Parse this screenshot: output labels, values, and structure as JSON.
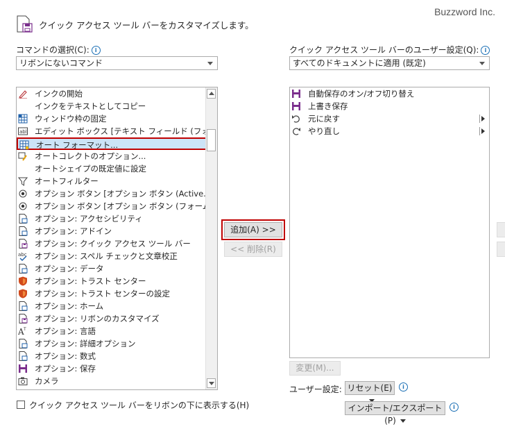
{
  "watermark": "Buzzword Inc.",
  "header": {
    "title": "クイック アクセス ツール バーをカスタマイズします。",
    "icon": "qat-customize-icon"
  },
  "commands_label": "コマンドの選択(C):",
  "commands_select_value": "リボンにないコマンド",
  "qat_label": "クイック アクセス ツール バーのユーザー設定(Q):",
  "qat_select_value": "すべてのドキュメントに適用 (既定)",
  "commands": [
    {
      "label": "インクの開始",
      "icon": "ink-pen-icon"
    },
    {
      "label": "インクをテキストとしてコピー",
      "icon": ""
    },
    {
      "label": "ウィンドウ枠の固定",
      "icon": "freeze-panes-icon"
    },
    {
      "label": "エディット ボックス [テキスト フィールド (フォー...",
      "icon": "edit-box-icon"
    },
    {
      "label": "オート フォーマット...",
      "icon": "autoformat-icon",
      "selected": true
    },
    {
      "label": "オートコレクトのオプション...",
      "icon": "autocorrect-icon"
    },
    {
      "label": "オートシェイプの既定値に設定",
      "icon": ""
    },
    {
      "label": "オートフィルター",
      "icon": "filter-icon"
    },
    {
      "label": "オプション ボタン [オプション ボタン (Active...",
      "icon": "radio-button-icon"
    },
    {
      "label": "オプション ボタン [オプション ボタン (フォーム ...",
      "icon": "radio-button-icon"
    },
    {
      "label": "オプション: アクセシビリティ",
      "icon": "options-doc-icon"
    },
    {
      "label": "オプション: アドイン",
      "icon": "options-doc-icon"
    },
    {
      "label": "オプション: クイック アクセス ツール バー",
      "icon": "options-qat-icon"
    },
    {
      "label": "オプション: スペル チェックと文章校正",
      "icon": "spelling-icon"
    },
    {
      "label": "オプション: データ",
      "icon": "options-doc-icon"
    },
    {
      "label": "オプション: トラスト センター",
      "icon": "shield-icon"
    },
    {
      "label": "オプション: トラスト センターの設定",
      "icon": "shield-icon"
    },
    {
      "label": "オプション: ホーム",
      "icon": "options-doc-icon"
    },
    {
      "label": "オプション: リボンのカスタマイズ",
      "icon": "options-qat-icon"
    },
    {
      "label": "オプション: 言語",
      "icon": "language-icon"
    },
    {
      "label": "オプション: 詳細オプション",
      "icon": "options-doc-icon"
    },
    {
      "label": "オプション: 数式",
      "icon": "options-doc-icon"
    },
    {
      "label": "オプション: 保存",
      "icon": "save-icon"
    },
    {
      "label": "カメラ",
      "icon": "camera-icon"
    }
  ],
  "qat_items": [
    {
      "label": "自動保存のオン/オフ切り替え",
      "icon": "save-icon",
      "submenu": false
    },
    {
      "label": "上書き保存",
      "icon": "save-icon",
      "submenu": false
    },
    {
      "label": "元に戻す",
      "icon": "undo-icon",
      "submenu": true
    },
    {
      "label": "やり直し",
      "icon": "redo-icon",
      "submenu": true
    }
  ],
  "add_button": "追加(A) >>",
  "remove_button": "<< 削除(R)",
  "modify_button": "変更(M)...",
  "user_settings_label": "ユーザー設定:",
  "reset_button": "リセット(E)",
  "import_export_button": "インポート/エクスポート(P)",
  "show_below_ribbon": "クイック アクセス ツール バーをリボンの下に表示する(H)",
  "info_glyph": "i",
  "colors": {
    "accent_red": "#c00000",
    "save_purple": "#7a2d8c",
    "shield_orange": "#d14a1c",
    "info_blue": "#1a6fb5"
  }
}
